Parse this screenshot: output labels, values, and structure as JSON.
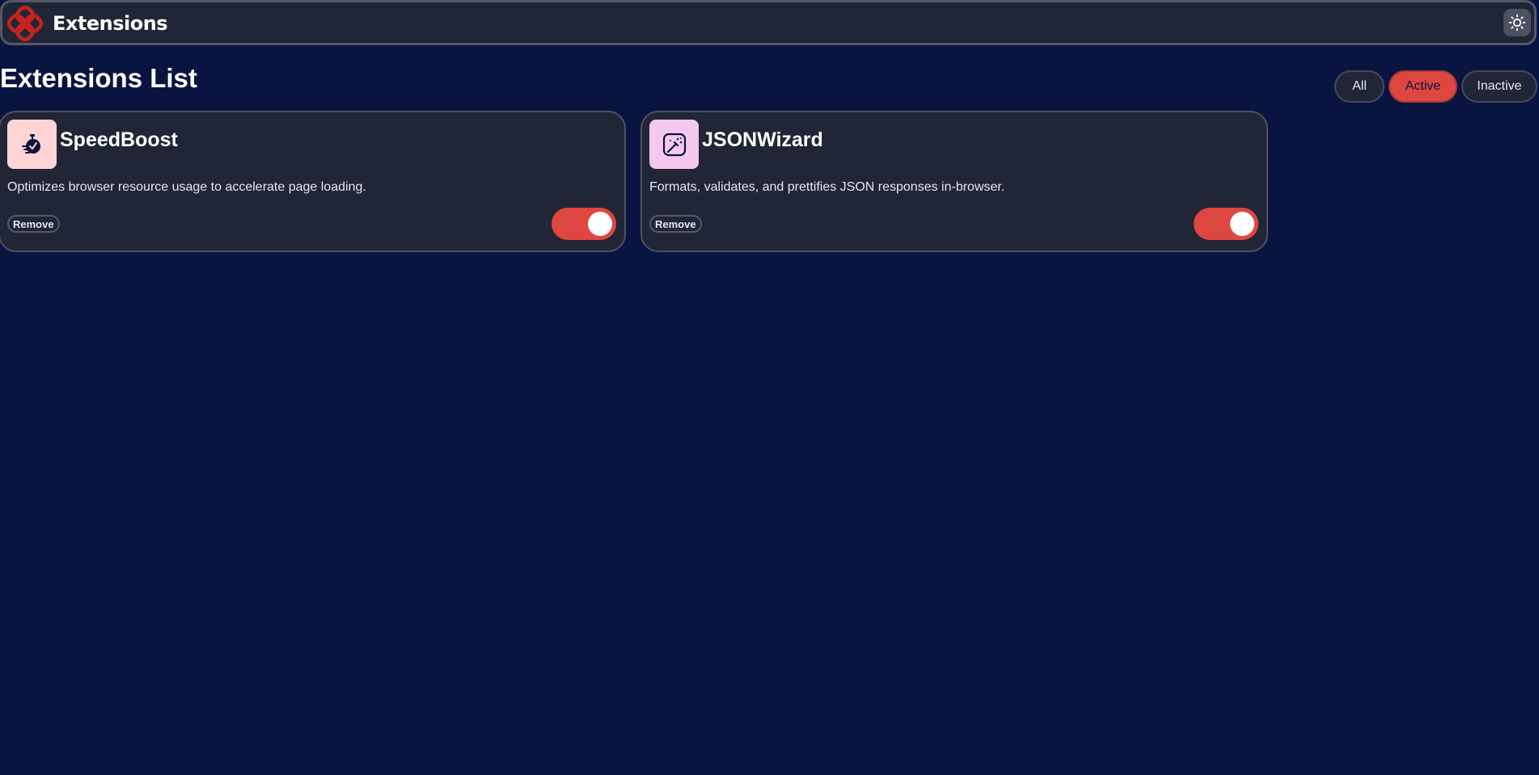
{
  "header": {
    "brand": "Extensions",
    "logo_icon": "extensions-logo-icon",
    "theme_toggle_icon": "sun-icon"
  },
  "main": {
    "title": "Extensions List",
    "filters": [
      {
        "label": "All",
        "selected": false
      },
      {
        "label": "Active",
        "selected": true
      },
      {
        "label": "Inactive",
        "selected": false
      }
    ],
    "extensions": [
      {
        "name": "SpeedBoost",
        "description": "Optimizes browser resource usage to accelerate page loading.",
        "icon": "stopwatch-icon",
        "icon_bg": "#ffd4d4",
        "remove_label": "Remove",
        "enabled": true
      },
      {
        "name": "JSONWizard",
        "description": "Formats, validates, and prettifies JSON responses in-browser.",
        "icon": "magic-wand-icon",
        "icon_bg": "#f5c8f0",
        "remove_label": "Remove",
        "enabled": true
      }
    ]
  },
  "colors": {
    "background": "#091540",
    "surface": "#212636",
    "accent": "#de473f"
  }
}
